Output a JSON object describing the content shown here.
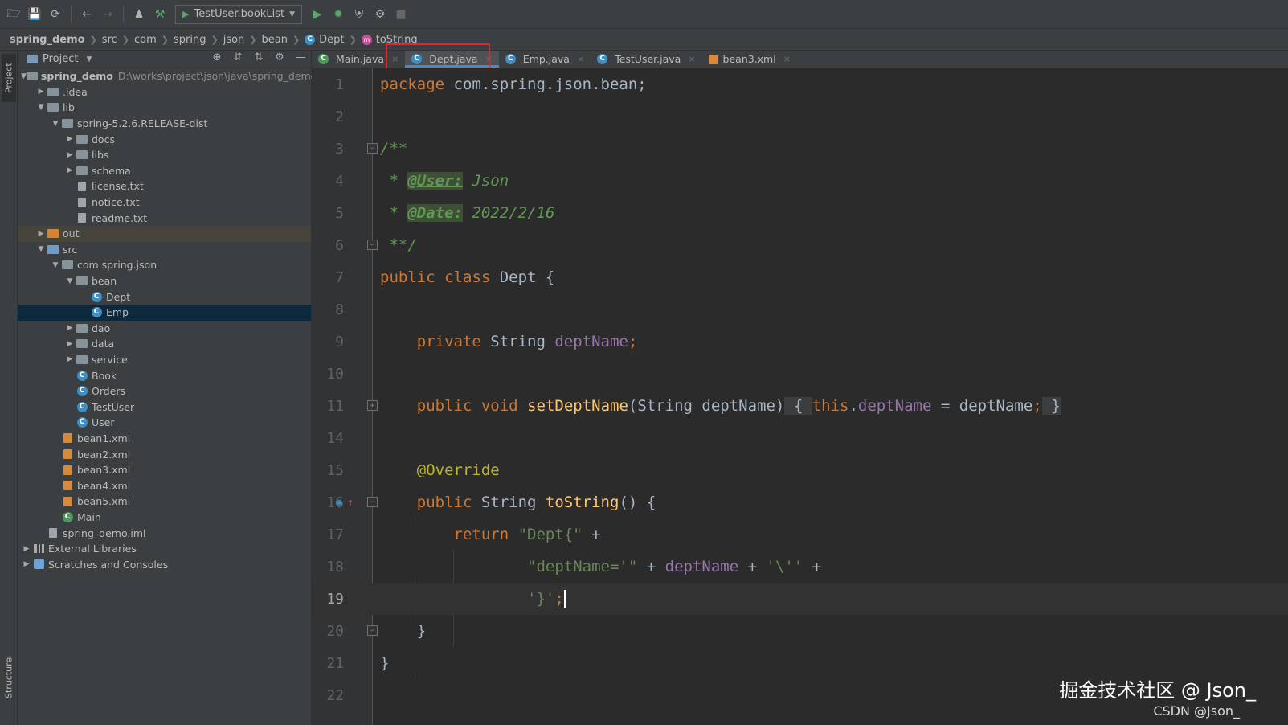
{
  "toolbar": {
    "run_config": "TestUser.bookList"
  },
  "breadcrumb": [
    "spring_demo",
    "src",
    "com",
    "spring",
    "json",
    "bean",
    "Dept",
    "toString"
  ],
  "project_panel": {
    "title": "Project",
    "root_name": "spring_demo",
    "root_path": "D:\\works\\project\\json\\java\\spring_demo",
    "items": [
      {
        "label": ".idea"
      },
      {
        "label": "lib"
      },
      {
        "label": "spring-5.2.6.RELEASE-dist"
      },
      {
        "label": "docs"
      },
      {
        "label": "libs"
      },
      {
        "label": "schema"
      },
      {
        "label": "license.txt"
      },
      {
        "label": "notice.txt"
      },
      {
        "label": "readme.txt"
      },
      {
        "label": "out"
      },
      {
        "label": "src"
      },
      {
        "label": "com.spring.json"
      },
      {
        "label": "bean"
      },
      {
        "label": "Dept"
      },
      {
        "label": "Emp"
      },
      {
        "label": "dao"
      },
      {
        "label": "data"
      },
      {
        "label": "service"
      },
      {
        "label": "Book"
      },
      {
        "label": "Orders"
      },
      {
        "label": "TestUser"
      },
      {
        "label": "User"
      },
      {
        "label": "bean1.xml"
      },
      {
        "label": "bean2.xml"
      },
      {
        "label": "bean3.xml"
      },
      {
        "label": "bean4.xml"
      },
      {
        "label": "bean5.xml"
      },
      {
        "label": "Main"
      },
      {
        "label": "spring_demo.iml"
      },
      {
        "label": "External Libraries"
      },
      {
        "label": "Scratches and Consoles"
      }
    ]
  },
  "sidebar": {
    "project_tab": "Project",
    "structure_tab": "Structure"
  },
  "tabs": [
    "Main.java",
    "Dept.java",
    "Emp.java",
    "TestUser.java",
    "bean3.xml"
  ],
  "editor": {
    "line_numbers": [
      "1",
      "2",
      "3",
      "4",
      "5",
      "6",
      "7",
      "8",
      "9",
      "10",
      "11",
      "14",
      "15",
      "16",
      "17",
      "18",
      "19",
      "20",
      "21",
      "22"
    ],
    "current_line": "19"
  },
  "watermark": {
    "main": "掘金技术社区 @ Json_",
    "sub": "CSDN @Json_"
  },
  "colors": {
    "keyword": "#cc7832",
    "string": "#6a8759",
    "field": "#9876aa",
    "function": "#ffc66d",
    "annotation": "#bbb529",
    "selection": "#0d293e",
    "highlight_box": "#e8232d"
  }
}
